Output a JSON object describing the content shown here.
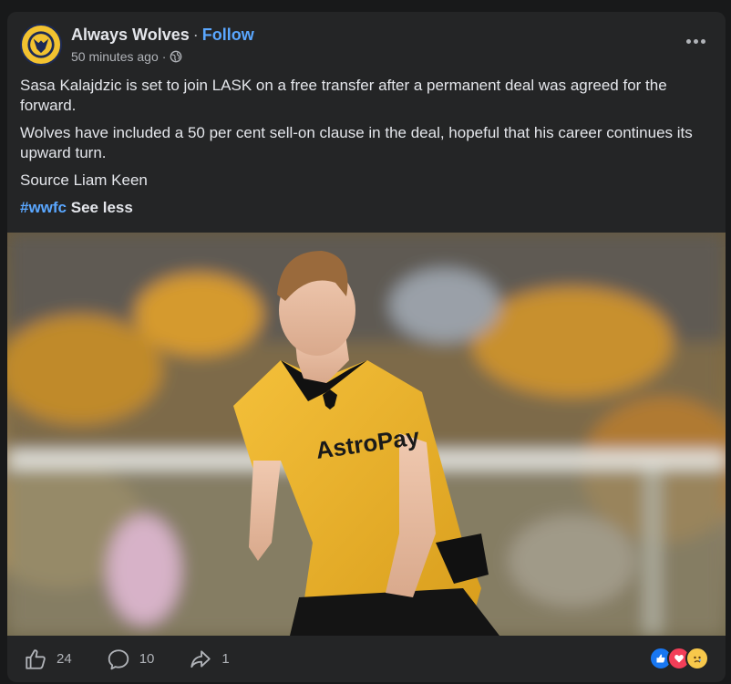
{
  "post": {
    "page_name": "Always Wolves",
    "separator": "·",
    "follow_label": "Follow",
    "timestamp": "50 minutes ago",
    "meta_separator": "·",
    "audience_icon": "globe-icon",
    "more_icon": "more-options-icon",
    "paragraphs": [
      "Sasa Kalajdzic is set to join LASK on a free transfer after a permanent deal was agreed for the forward.",
      "Wolves have included a 50 per cent sell-on clause in the deal, hopeful that his career continues its upward turn.",
      "Source Liam Keen"
    ],
    "hashtag": "#wwfc",
    "see_less_label": "See less"
  },
  "photo": {
    "description_icon": "post-photo",
    "shirt_sponsor": "AstroPay"
  },
  "actions": {
    "like_count": "24",
    "comment_count": "10",
    "share_count": "1",
    "like_icon": "thumbs-up-icon",
    "comment_icon": "comment-icon",
    "share_icon": "share-icon",
    "reactions": [
      "like-reaction-icon",
      "love-reaction-icon",
      "sad-reaction-icon"
    ]
  },
  "colors": {
    "background": "#18191a",
    "card": "#242526",
    "accent": "#5aa7ff",
    "text": "#e4e6eb",
    "muted": "#b0b3b8"
  }
}
